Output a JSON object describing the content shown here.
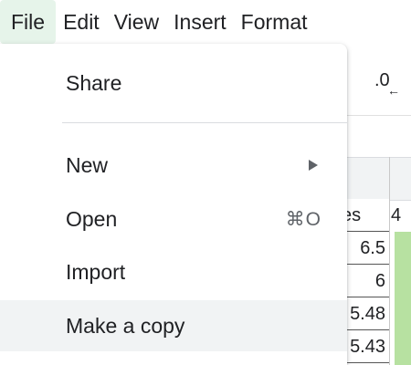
{
  "menubar": {
    "items": [
      {
        "label": "File"
      },
      {
        "label": "Edit"
      },
      {
        "label": "View"
      },
      {
        "label": "Insert"
      },
      {
        "label": "Format"
      }
    ]
  },
  "file_menu": {
    "share": {
      "label": "Share"
    },
    "new": {
      "label": "New",
      "icon": "submenu-arrow-icon"
    },
    "open": {
      "label": "Open",
      "shortcut": "⌘O"
    },
    "import": {
      "label": "Import"
    },
    "make_copy": {
      "label": "Make a copy"
    }
  },
  "toolbar": {
    "decrease_decimal": {
      "glyph": ".0",
      "arrow": "←"
    }
  },
  "sheet": {
    "column_header_fragment": "es",
    "next_column_fragment": "4",
    "cells": [
      "6.5",
      "6",
      "5.48",
      "5.43"
    ],
    "highlight_color": "#b7e1a1"
  },
  "colors": {
    "active_menu_bg": "#e6f4ea",
    "hover_item_bg": "#f1f3f4",
    "text": "#202124",
    "muted": "#5f6368"
  }
}
